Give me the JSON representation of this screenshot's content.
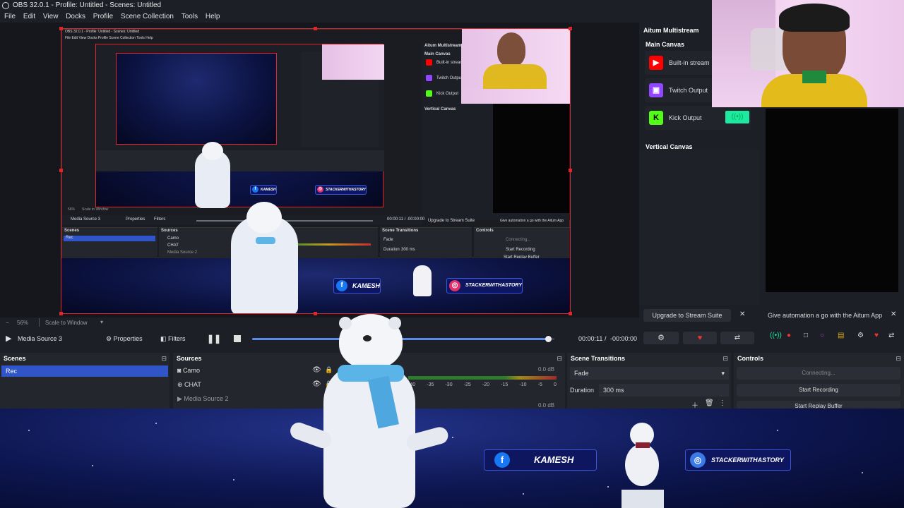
{
  "window": {
    "title": "OBS 32.0.1 - Profile: Untitled - Scenes: Untitled"
  },
  "menu": [
    "File",
    "Edit",
    "View",
    "Docks",
    "Profile",
    "Scene Collection",
    "Tools",
    "Help"
  ],
  "preview": {
    "nested_title": "OBS 32.0.1 - Profile: Untitled - Scenes: Untitled",
    "nested_menu": "File   Edit   View   Docks   Profile   Scene Collection   Tools   Help",
    "nested_sidebar": {
      "title": "Aitum Multistream",
      "main": "Main Canvas",
      "builtin": "Built-in stream",
      "twitch": "Twitch Output",
      "kick": "Kick Output",
      "vertical": "Vertical Canvas"
    },
    "nested_media": "Media Source 3",
    "nested_props": "Properties",
    "nested_filters": "Filters",
    "nested_time": "00:00:11 / -00:00:00",
    "nested_scenes": "Scenes",
    "nested_sources": "Sources",
    "nested_transitions": "Scene Transitions",
    "nested_controls": "Controls",
    "nested_rec": "Rec",
    "nested_camo": "Camo",
    "nested_chat": "CHAT",
    "nested_ms2": "Media Source 2",
    "nested_fade": "Fade",
    "nested_duration": "Duration",
    "nested_ms": "300 ms",
    "nested_connecting": "Connecting...",
    "nested_start_rec": "Start Recording",
    "nested_replay": "Start Replay Buffer",
    "nested_upgrade": "Upgrade to Stream Suite",
    "nested_automation": "Give automation a go with the Aitum App",
    "nested_zoom": "56%",
    "nested_scale": "Scale to Window",
    "social_facebook": "KAMESH",
    "social_instagram": "STACKERWITHASTORY"
  },
  "zoom": {
    "value": "56%",
    "mode": "Scale to Window"
  },
  "media": {
    "source": "Media Source 3",
    "properties": "Properties",
    "filters": "Filters",
    "time": "00:00:11",
    "remaining": "-00:00:00",
    "separator": "/",
    "progress": 0.98
  },
  "aitum": {
    "title": "Aitum Multistream",
    "main_canvas": "Main Canvas",
    "outputs": [
      {
        "label": "Built-in stream",
        "color": "#ff0000",
        "icon": "youtube-icon"
      },
      {
        "label": "Twitch Output",
        "color": "#9146ff",
        "icon": "twitch-icon"
      },
      {
        "label": "Kick Output",
        "color": "#53fc18",
        "icon": "kick-icon"
      }
    ],
    "vertical_canvas": "Vertical Canvas",
    "upgrade": "Upgrade to Stream Suite",
    "automation": "Give automation a go with the Aitum App"
  },
  "panels": {
    "scenes": {
      "title": "Scenes",
      "items": [
        "Rec"
      ]
    },
    "sources": {
      "title": "Sources",
      "items": [
        "Camo",
        "CHAT",
        "Media Source 2"
      ]
    },
    "audio": {
      "db_top": "0.0 dB",
      "db_bottom": "0.0 dB",
      "ticks": [
        "-40",
        "-35",
        "-30",
        "-25",
        "-20",
        "-15",
        "-10",
        "-5",
        "0"
      ]
    },
    "transitions": {
      "title": "Scene Transitions",
      "fade": "Fade",
      "duration_label": "Duration",
      "duration_value": "300 ms"
    },
    "controls": {
      "title": "Controls",
      "connecting": "Connecting...",
      "start_recording": "Start Recording",
      "start_replay": "Start Replay Buffer"
    }
  },
  "overlay": {
    "facebook": "KAMESH",
    "instagram": "STACKERWITHASTORY"
  },
  "colors": {
    "accent": "#e0262b",
    "selection": "#2f55c8",
    "kick": "#1de9a0",
    "bg": "#1d1f26"
  }
}
